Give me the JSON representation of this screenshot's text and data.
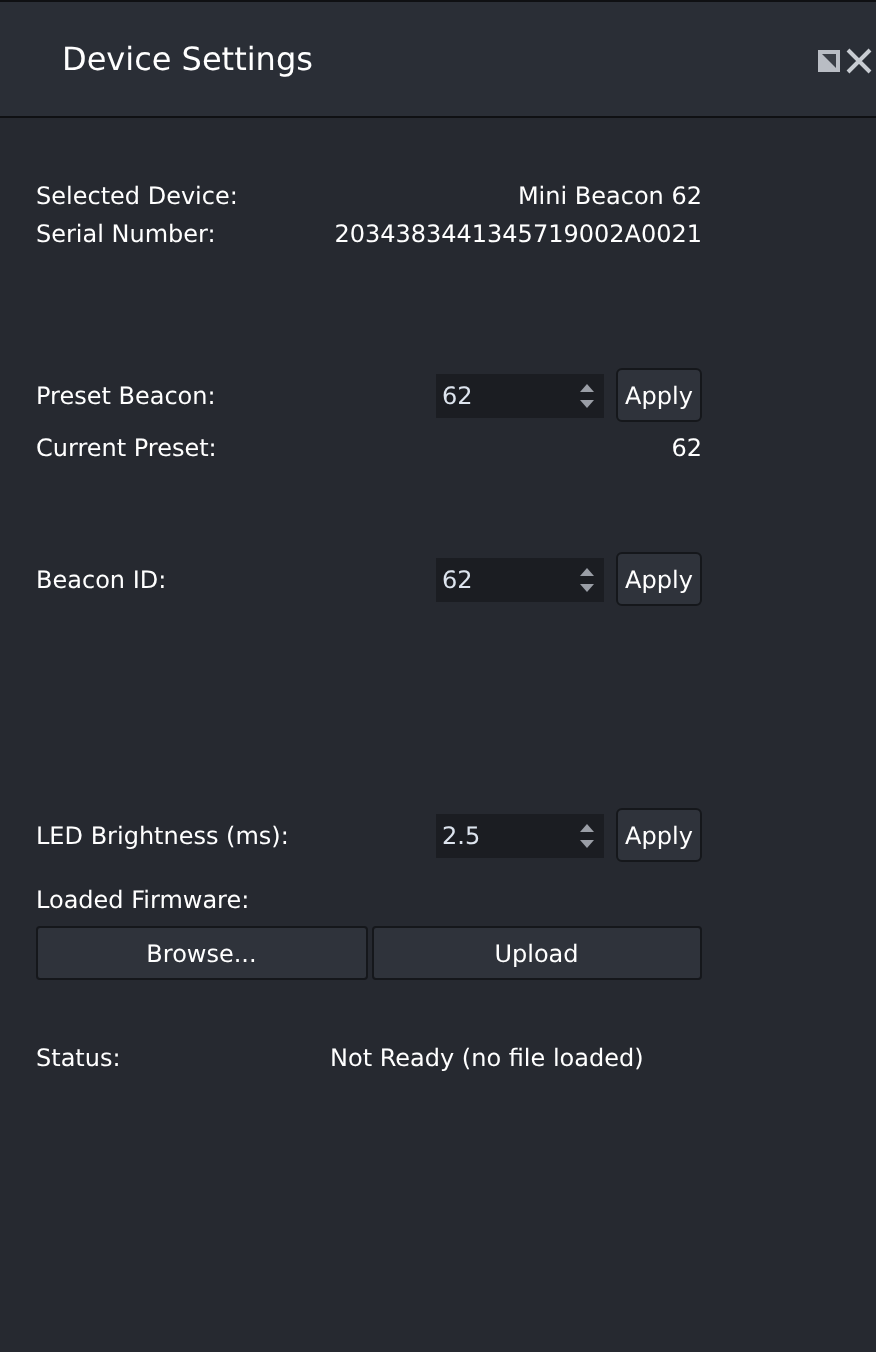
{
  "window": {
    "title": "Device Settings"
  },
  "device": {
    "selected_device_label": "Selected Device:",
    "selected_device": "Mini Beacon 62",
    "serial_label": "Serial Number:",
    "serial": "2034383441345719002A0021"
  },
  "preset": {
    "label": "Preset Beacon:",
    "value": "62",
    "button": "Apply",
    "current_label": "Current Preset:",
    "current": "62"
  },
  "beacon_id": {
    "label": "Beacon ID:",
    "value": "62",
    "button": "Apply"
  },
  "led": {
    "label": "LED Brightness (ms):",
    "value": "2.5",
    "button": "Apply"
  },
  "firmware": {
    "label": "Loaded Firmware:",
    "buttons": [
      "Browse...",
      "Upload"
    ]
  },
  "status": {
    "label": "Status:",
    "value": "Not Ready (no file loaded)"
  }
}
